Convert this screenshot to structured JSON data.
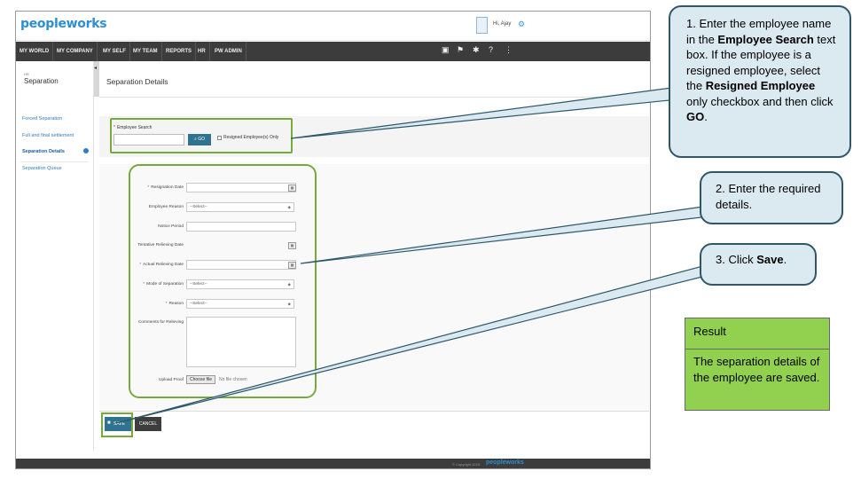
{
  "app": {
    "logo_main": "peopleworks",
    "user_greeting": "Hi, Ajay"
  },
  "nav": {
    "items": [
      "MY WORLD",
      "MY COMPANY",
      "MY SELF",
      "MY TEAM",
      "REPORTS",
      "HR",
      "PW ADMIN"
    ]
  },
  "sidebar": {
    "heading_small": "HR",
    "heading": "Separation",
    "items": [
      "Forced Separation",
      "Full and final settlement",
      "Separation Details",
      "Separation Queue"
    ]
  },
  "main": {
    "title": "Separation Details",
    "search": {
      "label": "Employee Search",
      "go_label": "GO",
      "resigned_label": "Resigned Employee(s) Only"
    },
    "form": {
      "resignation_date": "Resignation Date",
      "employee_reason": "Employee Reason",
      "notice_period": "Notice Period",
      "tentative_relieving_date": "Tentative Relieving Date",
      "actual_relieving_date": "Actual Relieving Date",
      "mode_of_separation": "Mode of Separation",
      "reason": "Reason",
      "comments_for_relieving": "Comments for Relieving",
      "upload_proof": "Upload Proof",
      "select_placeholder": "--Select--",
      "choose_file": "Choose file",
      "no_file": "No file chosen"
    },
    "buttons": {
      "save": "SAVE",
      "cancel": "CANCEL"
    }
  },
  "footer": {
    "copyright": "© Copyright 2015",
    "logo": "peopleworks"
  },
  "callouts": {
    "c1": {
      "p1": "1. Enter the employee name in the ",
      "b1": "Employee Search",
      "p2": " text box. If the employee is a resigned employee, select the ",
      "b2": "Resigned Employee",
      "p3": " only checkbox and then click ",
      "b3": "GO",
      "p4": "."
    },
    "c2": {
      "text": "2. Enter the required details."
    },
    "c3": {
      "p1": "3. Click ",
      "b1": "Save",
      "p2": "."
    }
  },
  "result": {
    "title": "Result",
    "text": "The separation details of the employee are saved."
  },
  "colors": {
    "highlight_green": "#76ab3b",
    "nav_dark": "#3c3c3c",
    "button_blue": "#30738f",
    "callout_fill": "#dbe9f1",
    "callout_border": "#2f5768",
    "result_green": "#92d050"
  }
}
